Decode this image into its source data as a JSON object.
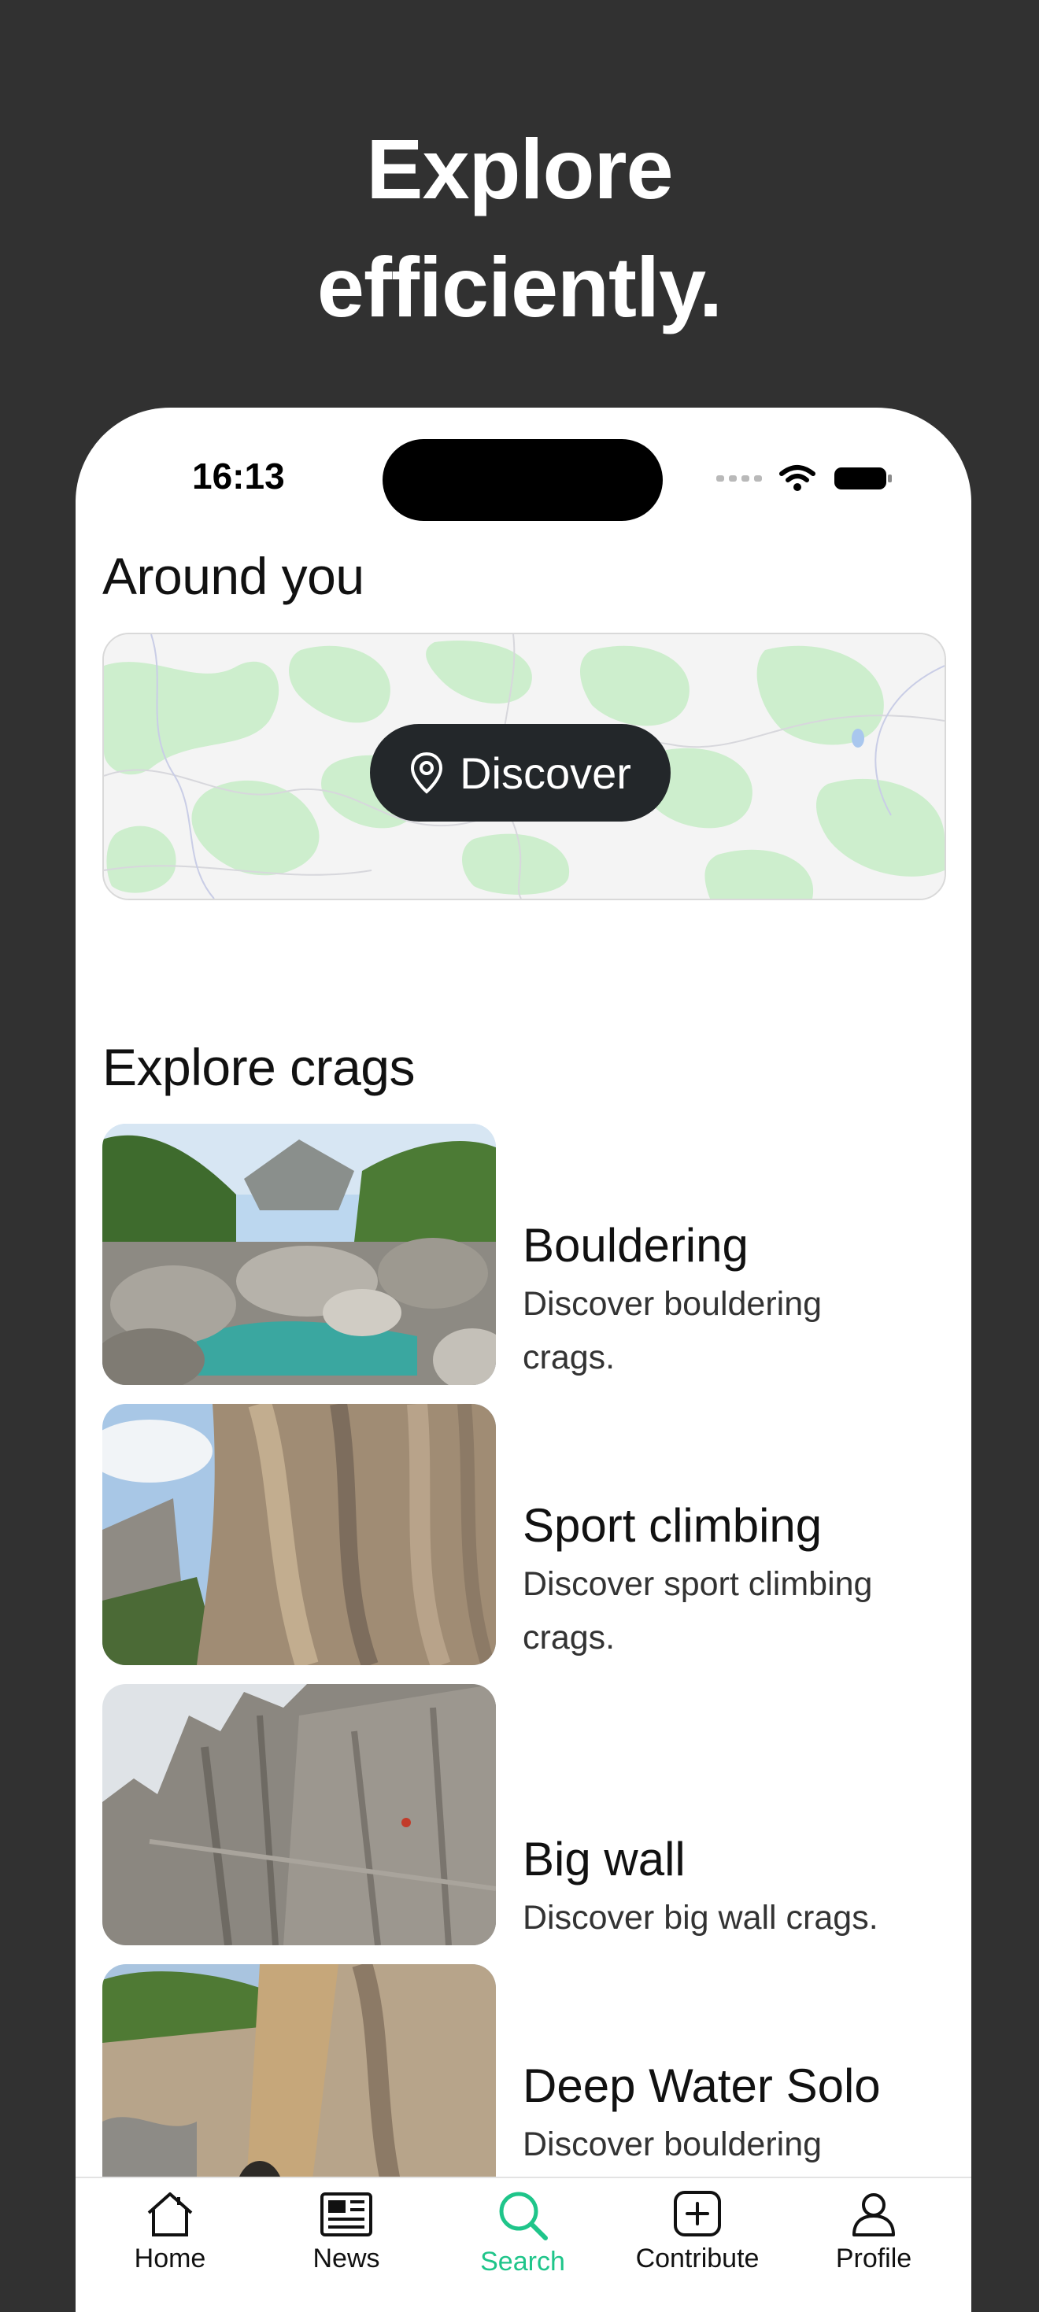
{
  "headline": {
    "line1": "Explore",
    "line2": "efficiently."
  },
  "status_bar": {
    "time": "16:13"
  },
  "around": {
    "title": "Around you",
    "discover_label": "Discover"
  },
  "explore": {
    "title": "Explore crags",
    "items": [
      {
        "name": "Bouldering",
        "desc_line1": "Discover bouldering",
        "desc_line2": "crags.",
        "image": "river-boulders-photo"
      },
      {
        "name": "Sport climbing",
        "desc_line1": "Discover sport climbing",
        "desc_line2": "crags.",
        "image": "limestone-wall-photo"
      },
      {
        "name": "Big wall",
        "desc_line1": "Discover big wall crags.",
        "desc_line2": "",
        "image": "dolomite-spires-photo"
      },
      {
        "name": "Deep Water Solo",
        "desc_line1": "Discover bouldering",
        "desc_line2": "",
        "image": "sea-cliff-photo"
      }
    ]
  },
  "tabbar": {
    "items": [
      {
        "label": "Home",
        "icon": "house-icon"
      },
      {
        "label": "News",
        "icon": "newspaper-icon"
      },
      {
        "label": "Search",
        "icon": "search-icon",
        "active": true
      },
      {
        "label": "Contribute",
        "icon": "plus-square-icon"
      },
      {
        "label": "Profile",
        "icon": "person-icon"
      }
    ]
  },
  "colors": {
    "background": "#313131",
    "accent": "#1fc58a",
    "button_dark": "#23272a",
    "map_green": "#cdeecd"
  }
}
